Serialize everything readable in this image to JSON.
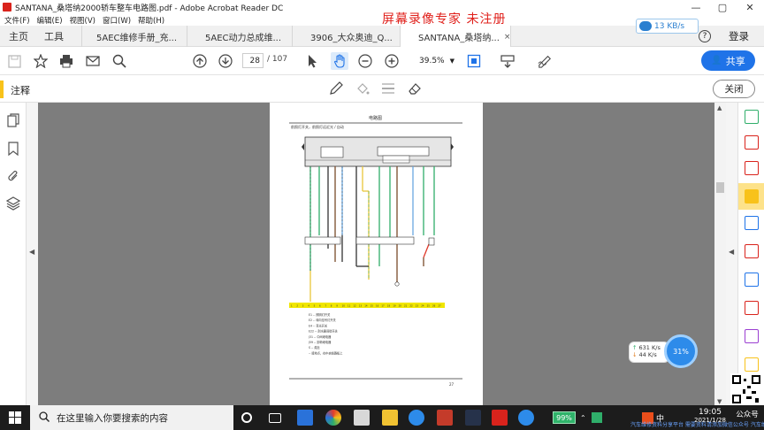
{
  "window": {
    "title": "SANTANA_桑塔纳2000轿车整车电路图.pdf - Adobe Acrobat Reader DC",
    "watermark": "屏幕录像专家  未注册",
    "controls": {
      "minimize": "—",
      "maximize": "▢",
      "close": "✕"
    }
  },
  "menu": [
    "文件(F)",
    "编辑(E)",
    "视图(V)",
    "窗口(W)",
    "帮助(H)"
  ],
  "tabs": {
    "home": "主页",
    "tools": "工具",
    "docs": [
      {
        "label": "5AEC维修手册_充...",
        "active": false
      },
      {
        "label": "5AEC动力总成维...",
        "active": false
      },
      {
        "label": "3906_大众奥迪_Q...",
        "active": false
      },
      {
        "label": "SANTANA_桑塔纳...",
        "active": true
      }
    ],
    "close_glyph": "×"
  },
  "network_speed": "13 KB/s",
  "help": "?",
  "login": "登录",
  "toolbar": {
    "page_current": "28",
    "page_total": "/ 107",
    "zoom": "39.5%",
    "share": "共享",
    "icons": [
      "save-icon",
      "bookmark-star-icon",
      "print-icon",
      "email-icon",
      "search-icon",
      "page-up-icon",
      "page-down-icon",
      "select-arrow-icon",
      "hand-icon",
      "zoom-out-icon",
      "zoom-in-icon",
      "fit-page-icon",
      "scroll-mode-icon",
      "sign-icon"
    ]
  },
  "annotation_bar": {
    "label": "注释",
    "close": "关闭",
    "tools": [
      "pen-icon",
      "fill-icon",
      "lines-icon",
      "eraser-icon"
    ]
  },
  "document": {
    "header_title": "电路图",
    "subtitle": "前照灯开关，前照灯远近光 / 自动",
    "page_number": "27",
    "legend": [
      "E1 -- 照明灯开关",
      "E2 -- 转向信号灯开关",
      "E4 -- 变光开关",
      "E22 -- 刮水器间歇开关",
      "J31 -- 中间继电器",
      "J59 -- 卸荷继电器",
      "S -- 熔丝",
      "-- 接地点，在中央线路板上"
    ],
    "bottom_strip": [
      "1",
      "2",
      "3",
      "4",
      "5",
      "6",
      "7",
      "8",
      "9",
      "10",
      "11",
      "12",
      "13",
      "14",
      "15",
      "16",
      "17",
      "18",
      "19",
      "20",
      "21",
      "22",
      "23",
      "24",
      "25",
      "26",
      "27"
    ]
  },
  "speed_widget": {
    "up": "631 K/s",
    "down": "44 K/s",
    "cpu": "31%"
  },
  "taskbar": {
    "search_placeholder": "在这里输入你要搜索的内容",
    "battery": "99%",
    "ime": "中",
    "clock_time": "19:05",
    "clock_date": "2021/1/28",
    "qr_label": "公众号",
    "ticker": "汽车维修资料分享平台  需要资料请添加微信公众号  汽车维修资料分享"
  },
  "colors": {
    "accent_blue": "#1f73e8",
    "annot_yellow": "#f8c21a",
    "watermark_red": "#e0201b",
    "canvas_gray": "#7d7d7d"
  }
}
